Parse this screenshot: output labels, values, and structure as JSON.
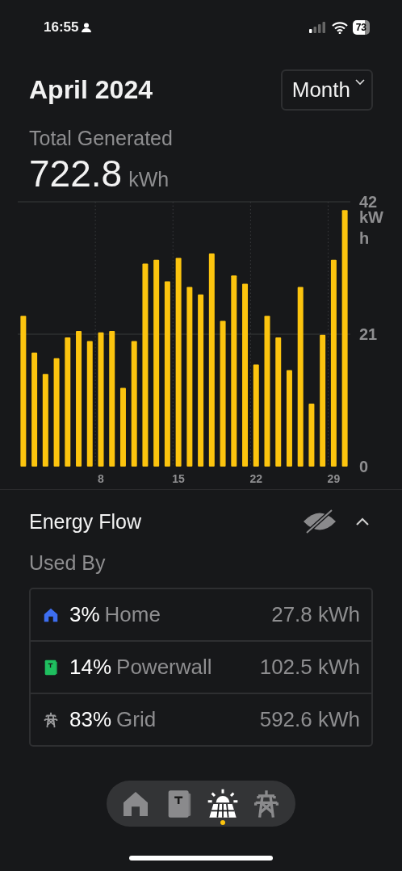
{
  "status_bar": {
    "time": "16:55",
    "battery": "73"
  },
  "header": {
    "title": "April 2024",
    "period_select": "Month"
  },
  "summary": {
    "label": "Total Generated",
    "value": "722.8",
    "unit": "kWh"
  },
  "chart_data": {
    "type": "bar",
    "x": [
      1,
      2,
      3,
      4,
      5,
      6,
      7,
      8,
      9,
      10,
      11,
      12,
      13,
      14,
      15,
      16,
      17,
      18,
      19,
      20,
      21,
      22,
      23,
      24,
      25,
      26,
      27,
      28,
      29,
      30
    ],
    "values": [
      23.9,
      18.1,
      14.7,
      17.2,
      20.5,
      21.5,
      19.9,
      21.3,
      21.5,
      12.5,
      19.9,
      32.2,
      32.8,
      29.4,
      33.1,
      28.5,
      27.3,
      33.8,
      23.1,
      30.3,
      29.0,
      16.2,
      23.9,
      20.5,
      15.3,
      28.5,
      10.0,
      20.9,
      32.8,
      40.7
    ],
    "ylim": [
      0,
      42
    ],
    "yticks": [
      0,
      21,
      42
    ],
    "ylabel": "kWh",
    "xlim": [
      0.5,
      30.5
    ],
    "xticks": [
      8,
      15,
      22,
      29
    ]
  },
  "energy_flow": {
    "title": "Energy Flow",
    "subtitle": "Used By",
    "expanded": true,
    "rows": [
      {
        "kind": "home",
        "percent": "3%",
        "name": "Home",
        "value": "27.8 kWh"
      },
      {
        "kind": "powerwall",
        "percent": "14%",
        "name": "Powerwall",
        "value": "102.5 kWh"
      },
      {
        "kind": "grid",
        "percent": "83%",
        "name": "Grid",
        "value": "592.6 kWh"
      }
    ]
  },
  "tabs": [
    {
      "kind": "home",
      "selected": false
    },
    {
      "kind": "powerwall",
      "selected": false
    },
    {
      "kind": "solar",
      "selected": true
    },
    {
      "kind": "grid",
      "selected": false
    }
  ]
}
